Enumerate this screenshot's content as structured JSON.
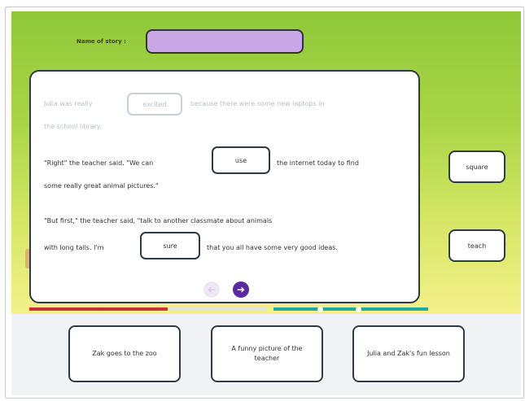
{
  "header": {
    "name_label": "Name of story :",
    "name_value": ""
  },
  "passage": {
    "line1_a": "Julia was really",
    "blank1": "excited",
    "line1_b": "because there were some new laptops in",
    "line2": "the school library.",
    "line3_a": "\"Right\" the teacher said. \"We can",
    "blank2": "use",
    "line3_b": "the internet today to find",
    "line4": "some really great animal pictures.\"",
    "line5": "\"But first,\" the teacher said, \"talk to another classmate about animals",
    "line6_a": "with long tails. I'm",
    "blank3": "sure",
    "line6_b": "that you all have some very good ideas."
  },
  "nav": {
    "prev_icon": "arrow-left-icon",
    "next_icon": "arrow-right-icon"
  },
  "word_tiles": [
    "square",
    "teach"
  ],
  "story_choices": [
    "Zak goes to the zoo",
    "A funny picture of the teacher",
    "Julia and Zak's fun lesson"
  ],
  "progress": {
    "completed_fraction": 0.36
  },
  "colors": {
    "name_input": "#c9a7e6",
    "nav_next": "#5b2aa0",
    "progress_red": "#c5323c",
    "progress_teal": "#24a7a4"
  }
}
